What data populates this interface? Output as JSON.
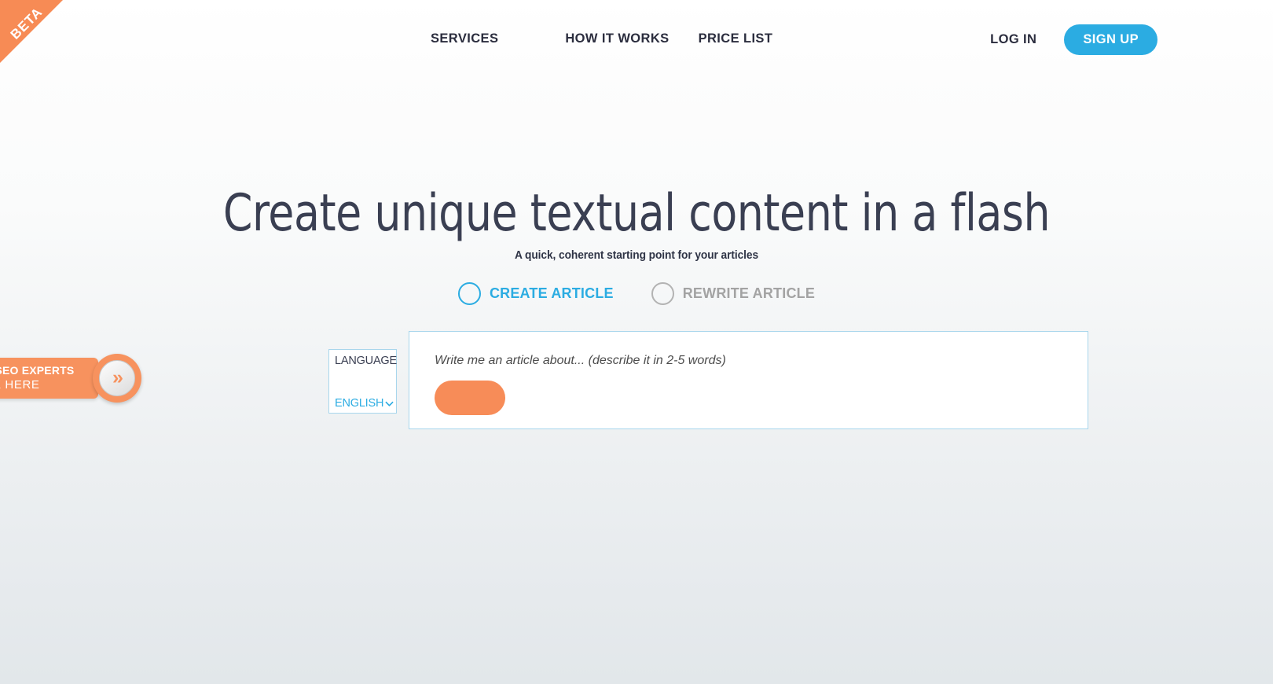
{
  "ribbon": {
    "label": "BETA",
    "color": "#f78b55"
  },
  "nav": {
    "links": [
      {
        "label": "SERVICES",
        "name": "nav-link-services"
      },
      {
        "label": "HOW IT WORKS",
        "name": "nav-link-how-it-works"
      },
      {
        "label": "PRICE LIST",
        "name": "nav-link-price-list"
      }
    ],
    "login_label": "LOG IN",
    "signup_label": "SIGN UP",
    "signup_color": "#2bace2"
  },
  "hero": {
    "title": "Create unique textual content in a flash",
    "subtitle": "A quick, coherent starting point for your articles"
  },
  "modes": {
    "options": [
      {
        "label": "CREATE ARTICLE",
        "selected": true,
        "color": "#2bace2"
      },
      {
        "label": "REWRITE ARTICLE",
        "selected": false,
        "color": "#a3a3a3"
      }
    ]
  },
  "language": {
    "label": "LANGUAGE",
    "selected": "ENGLISH",
    "options": [
      "ENGLISH"
    ],
    "chevron_icon": "chevron-down-icon",
    "accent": "#2bace2"
  },
  "input_card": {
    "placeholder": "Write me an article about... (describe it in 2-5 words)",
    "value": "",
    "button_label": "",
    "button_color": "#f78c58",
    "border_color": "#a8d6ec"
  },
  "promo": {
    "line1": "GENCIES & SEO EXPERTS",
    "line2": "CLICK HERE",
    "chevron_icon": "double-chevron-right-icon",
    "chevron_glyph": "»",
    "color": "#f7925e"
  }
}
